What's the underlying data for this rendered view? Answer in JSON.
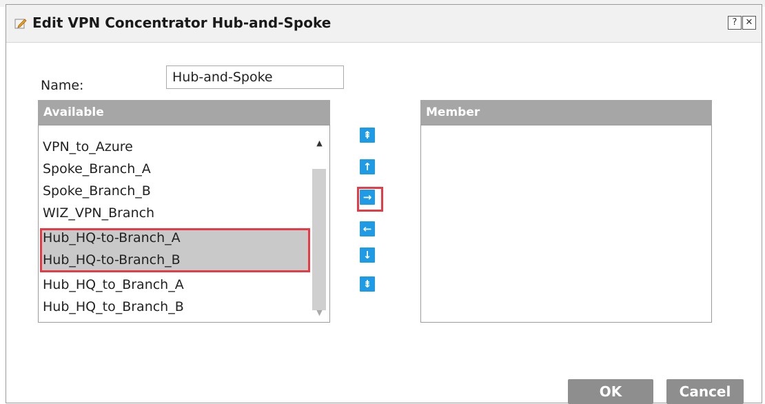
{
  "dialog": {
    "title": "Edit VPN Concentrator Hub-and-Spoke",
    "help_glyph": "?",
    "close_glyph": "✕"
  },
  "form": {
    "name_label": "Name:",
    "name_value": "Hub-and-Spoke"
  },
  "available": {
    "header": "Available",
    "items": [
      {
        "label": "VPN_to_Azure",
        "selected": false
      },
      {
        "label": "Spoke_Branch_A",
        "selected": false
      },
      {
        "label": "Spoke_Branch_B",
        "selected": false
      },
      {
        "label": "WIZ_VPN_Branch",
        "selected": false
      },
      {
        "label": "Hub_HQ-to-Branch_A",
        "selected": true
      },
      {
        "label": "Hub_HQ-to-Branch_B",
        "selected": true
      },
      {
        "label": "Hub_HQ_to_Branch_A",
        "selected": false
      },
      {
        "label": "Hub_HQ_to_Branch_B",
        "selected": false
      }
    ]
  },
  "member": {
    "header": "Member",
    "items": []
  },
  "move_buttons": [
    {
      "name": "move-top-button",
      "glyph": "⇞"
    },
    {
      "name": "move-up-button",
      "glyph": "↑"
    },
    {
      "name": "add-to-member-button",
      "glyph": "→"
    },
    {
      "name": "remove-from-member-button",
      "glyph": "←"
    },
    {
      "name": "move-down-button",
      "glyph": "↓"
    },
    {
      "name": "move-bottom-button",
      "glyph": "⇟"
    }
  ],
  "footer": {
    "ok_label": "OK",
    "cancel_label": "Cancel"
  },
  "colors": {
    "accent_blue": "#1f9be6",
    "highlight_red": "#e83a45",
    "header_gray": "#a6a6a6",
    "button_gray": "#8e8e8e"
  }
}
